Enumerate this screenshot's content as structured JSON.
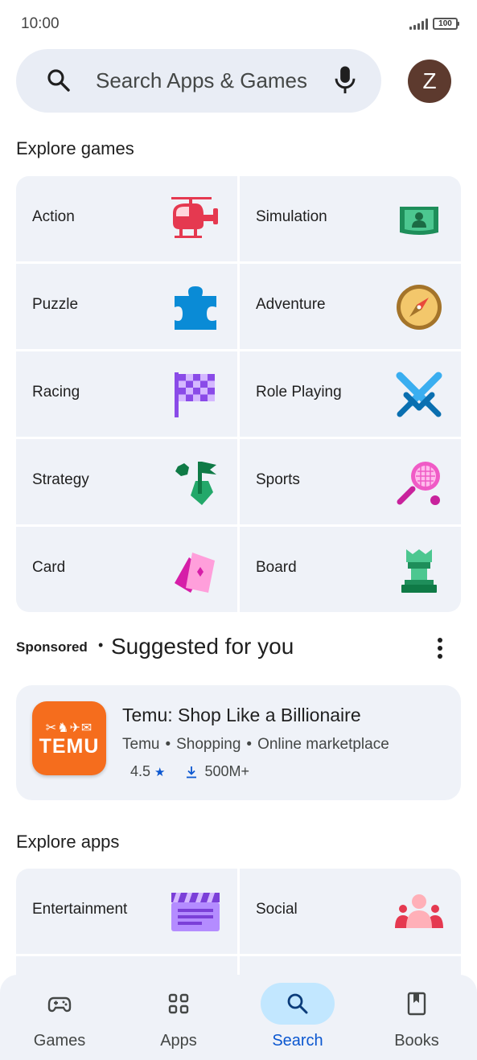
{
  "status_bar": {
    "time": "10:00",
    "battery": "100"
  },
  "search": {
    "placeholder": "Search Apps & Games",
    "avatar_letter": "Z"
  },
  "explore_games": {
    "title": "Explore games",
    "categories": [
      {
        "label": "Action",
        "icon": "helicopter-icon"
      },
      {
        "label": "Simulation",
        "icon": "stadium-icon"
      },
      {
        "label": "Puzzle",
        "icon": "puzzle-piece-icon"
      },
      {
        "label": "Adventure",
        "icon": "compass-icon"
      },
      {
        "label": "Racing",
        "icon": "checkered-flag-icon"
      },
      {
        "label": "Role Playing",
        "icon": "crossed-swords-icon"
      },
      {
        "label": "Strategy",
        "icon": "strategy-flag-icon"
      },
      {
        "label": "Sports",
        "icon": "tennis-racket-icon"
      },
      {
        "label": "Card",
        "icon": "playing-cards-icon"
      },
      {
        "label": "Board",
        "icon": "chess-rook-icon"
      }
    ]
  },
  "suggested": {
    "sponsored_label": "Sponsored",
    "separator": "•",
    "title": "Suggested for you",
    "app": {
      "name": "Temu: Shop Like a Billionaire",
      "icon_text": "TEMU",
      "developer": "Temu",
      "category": "Shopping",
      "tag": "Online marketplace",
      "rating": "4.5",
      "downloads": "500M+",
      "brand_color": "#f56d1d"
    }
  },
  "explore_apps": {
    "title": "Explore apps",
    "categories": [
      {
        "label": "Entertainment",
        "icon": "clapperboard-icon"
      },
      {
        "label": "Social",
        "icon": "people-group-icon"
      }
    ]
  },
  "bottom_nav": {
    "items": [
      {
        "label": "Games",
        "icon": "gamepad-icon",
        "active": false
      },
      {
        "label": "Apps",
        "icon": "apps-grid-icon",
        "active": false
      },
      {
        "label": "Search",
        "icon": "search-icon",
        "active": true
      },
      {
        "label": "Books",
        "icon": "book-icon",
        "active": false
      }
    ]
  },
  "colors": {
    "accent": "#0b57d0",
    "active_pill": "#c2e7ff",
    "card_bg": "#eff2f8"
  }
}
